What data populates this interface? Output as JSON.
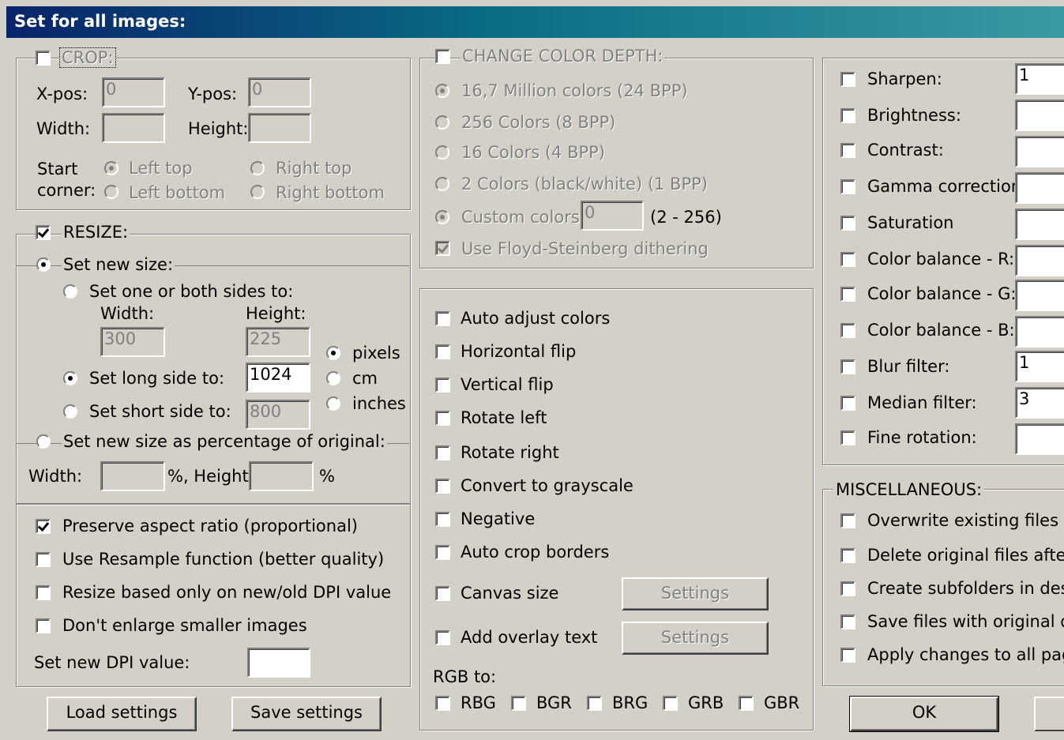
{
  "title": "Set for all images:",
  "crop": {
    "label": "CROP:",
    "xpos_label": "X-pos:",
    "xpos_value": "0",
    "ypos_label": "Y-pos:",
    "ypos_value": "0",
    "width_label": "Width:",
    "height_label": "Height:",
    "start_label": "Start",
    "corner_label": "corner:",
    "left_top": "Left top",
    "right_top": "Right top",
    "left_bottom": "Left bottom",
    "right_bottom": "Right bottom"
  },
  "resize": {
    "label": "RESIZE:",
    "set_new_size": "Set new size:",
    "one_or_both": "Set one or both sides to:",
    "width_label": "Width:",
    "height_label": "Height:",
    "width_value": "300",
    "height_value": "225",
    "long_side_label": "Set long side to:",
    "long_side_value": "1024",
    "short_side_label": "Set short side to:",
    "short_side_value": "800",
    "pixels": "pixels",
    "cm": "cm",
    "inches": "inches",
    "percentage_label": "Set new size as percentage of original:",
    "pct_width_label": "Width:",
    "pct_height_label": "%, Height:",
    "pct_suffix": "%"
  },
  "options": {
    "preserve_aspect": "Preserve aspect ratio (proportional)",
    "use_resample": "Use Resample function (better quality)",
    "resize_dpi": "Resize based only on new/old DPI value",
    "dont_enlarge": "Don't enlarge smaller images",
    "dpi_label": "Set new DPI value:"
  },
  "buttons": {
    "load": "Load settings",
    "save": "Save settings",
    "ok": "OK",
    "settings": "Settings"
  },
  "color_depth": {
    "label": "CHANGE COLOR DEPTH:",
    "opt_24": "16,7 Million colors (24 BPP)",
    "opt_8": "256 Colors (8 BPP)",
    "opt_4": "16 Colors (4 BPP)",
    "opt_1": "2 Colors (black/white) (1 BPP)",
    "custom_label": "Custom colors:",
    "custom_value": "0",
    "custom_range": "(2 - 256)",
    "dithering": "Use Floyd-Steinberg dithering"
  },
  "adjust": {
    "auto_adjust": "Auto adjust colors",
    "hflip": "Horizontal flip",
    "vflip": "Vertical flip",
    "rotate_left": "Rotate left",
    "rotate_right": "Rotate right",
    "grayscale": "Convert to grayscale",
    "negative": "Negative",
    "auto_crop": "Auto crop borders",
    "canvas_size": "Canvas size",
    "overlay_text": "Add overlay text",
    "rgb_to": "RGB to:",
    "rgb_options": [
      "RBG",
      "BGR",
      "BRG",
      "GRB",
      "GBR"
    ]
  },
  "filters": {
    "sharpen": "Sharpen:",
    "sharpen_value": "1",
    "brightness": "Brightness:",
    "contrast": "Contrast:",
    "gamma": "Gamma correction:",
    "saturation": "Saturation",
    "balance_r": "Color balance - R:",
    "balance_g": "Color balance - G:",
    "balance_b": "Color balance - B:",
    "blur": "Blur filter:",
    "blur_value": "1",
    "median": "Median filter:",
    "median_value": "3",
    "fine_rotation": "Fine rotation:"
  },
  "misc": {
    "label": "MISCELLANEOUS:",
    "overwrite": "Overwrite existing files",
    "delete_orig": "Delete original files after co",
    "subfolders": "Create subfolders in destin",
    "orig_date": "Save files with original date",
    "all_pages": "Apply changes to all pages"
  }
}
